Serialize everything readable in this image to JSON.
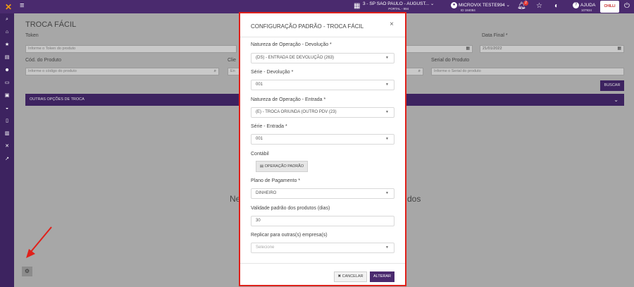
{
  "topbar": {
    "logo": "✕",
    "store_name": "3 - SP SAO PAULO - AUGUST...",
    "store_sub": "PORTAL - 994",
    "user_name": "MICROVIX TESTE994",
    "user_sub": "ID 184084",
    "notification_count": "2",
    "help_label": "AJUDA",
    "help_sub": "107934",
    "brand": "CHILLI BEANS"
  },
  "sidebar": {
    "items": [
      "search-icon",
      "home-icon",
      "star-icon",
      "document-icon",
      "users-icon",
      "laptop-icon",
      "desktop-icon",
      "cow-icon",
      "file-icon",
      "clipboard-icon",
      "tools-icon",
      "chart-icon"
    ]
  },
  "page": {
    "title": "TROCA FÁCIL",
    "token_label": "Token",
    "token_placeholder": "Informe o Token do produto",
    "data_final_label": "Data Final *",
    "data_final_value": "21/01/2022",
    "cod_produto_label": "Cód. do Produto",
    "cod_produto_placeholder": "Informe o código do produto",
    "cliente_label": "Clie",
    "cliente_placeholder": "En",
    "serial_label": "Serial do Produto",
    "serial_placeholder": "Informe o Serial do produto",
    "buscar_label": "BUSCAR",
    "outras_opcoes_label": "OUTRAS OPÇÕES DE TROCA",
    "bg_text_left": "Ne",
    "bg_text_right": "dos"
  },
  "modal": {
    "title": "CONFIGURAÇÃO PADRÃO - TROCA FÁCIL",
    "close": "×",
    "natureza_devolucao_label": "Natureza de Operação - Devolução *",
    "natureza_devolucao_value": "(DS) - ENTRADA DE DEVOLUÇÃO (263)",
    "serie_devolucao_label": "Série - Devolução *",
    "serie_devolucao_value": "001",
    "natureza_entrada_label": "Natureza de Operação - Entrada *",
    "natureza_entrada_value": "(E) - TROCA ORIUNDA (OUTRO PDV (23)",
    "serie_entrada_label": "Série - Entrada *",
    "serie_entrada_value": "001",
    "contabil_label": "Contábil",
    "operacao_padrao_label": "OPERAÇÃO PADRÃO",
    "plano_pagamento_label": "Plano de Pagamento *",
    "plano_pagamento_value": "DINHEIRO",
    "validade_label": "Validade padrão dos produtos (dias)",
    "validade_value": "30",
    "replicar_label": "Replicar para outras(s) empresa(s)",
    "replicar_placeholder": "Selecione",
    "cancelar_label": "CANCELAR",
    "alterar_label": "ALTERAR"
  },
  "colors": {
    "accent": "#4a2a6e",
    "highlight_border": "#e0201a",
    "arrow": "#e0201a"
  }
}
